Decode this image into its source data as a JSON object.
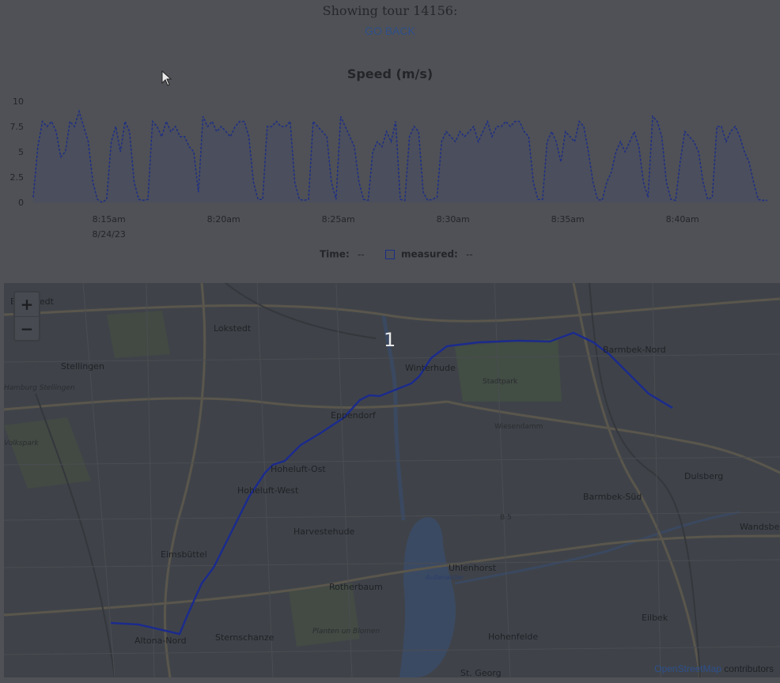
{
  "header": {
    "title": "Showing tour 14156:",
    "back_link": "GO BACK"
  },
  "chart": {
    "title": "Speed (m/s)"
  },
  "legend": {
    "time_label": "Time:",
    "time_value": "--",
    "series_label": "measured:",
    "series_value": "--"
  },
  "chart_data": {
    "type": "area",
    "title": "Speed (m/s)",
    "xlabel": "",
    "ylabel": "",
    "ylim": [
      0,
      10
    ],
    "yticks": [
      "0",
      "2.5",
      "5",
      "7.5",
      "10"
    ],
    "xticks": [
      {
        "time": "8:15am",
        "date": "8/24/23"
      },
      {
        "time": "8:20am",
        "date": ""
      },
      {
        "time": "8:25am",
        "date": ""
      },
      {
        "time": "8:30am",
        "date": ""
      },
      {
        "time": "8:35am",
        "date": ""
      },
      {
        "time": "8:40am",
        "date": ""
      }
    ],
    "x_minutes": [
      0,
      0.2,
      0.4,
      0.6,
      0.8,
      1.0,
      1.2,
      1.4,
      1.6,
      1.8,
      2.0,
      2.2,
      2.4,
      2.6,
      2.8,
      3.0,
      3.2,
      3.4,
      3.6,
      3.8,
      4.0,
      4.2,
      4.4,
      4.6,
      4.8,
      5.0,
      5.2,
      5.4,
      5.6,
      5.8,
      6.0,
      6.2,
      6.4,
      6.6,
      6.8,
      7.0,
      7.2,
      7.4,
      7.6,
      7.8,
      8.0,
      8.2,
      8.4,
      8.6,
      8.8,
      9.0,
      9.2,
      9.4,
      9.6,
      9.8,
      10.0,
      10.2,
      10.4,
      10.6,
      10.8,
      11.0,
      11.2,
      11.4,
      11.6,
      11.8,
      12.0,
      12.2,
      12.4,
      12.6,
      12.8,
      13.0,
      13.2,
      13.4,
      13.6,
      13.8,
      14.0,
      14.2,
      14.4,
      14.6,
      14.8,
      15.0,
      15.2,
      15.4,
      15.6,
      15.8,
      16.0,
      16.2,
      16.4,
      16.6,
      16.8,
      17.0,
      17.2,
      17.4,
      17.6,
      17.8,
      18.0,
      18.2,
      18.4,
      18.6,
      18.8,
      19.0,
      19.2,
      19.4,
      19.6,
      19.8,
      20.0,
      20.2,
      20.4,
      20.6,
      20.8,
      21.0,
      21.2,
      21.4,
      21.6,
      21.8,
      22.0,
      22.2,
      22.4,
      22.6,
      22.8,
      23.0,
      23.2,
      23.4,
      23.6,
      23.8,
      24.0,
      24.2,
      24.4,
      24.6,
      24.8,
      25.0,
      25.2,
      25.4,
      25.6,
      25.8,
      26.0,
      26.2,
      26.4,
      26.6,
      26.8,
      27.0,
      27.2,
      27.4,
      27.6,
      27.8,
      28.0,
      28.2,
      28.4,
      28.6,
      28.8,
      29.0,
      29.2,
      29.4,
      29.6,
      29.8,
      30.0,
      30.2,
      30.4,
      30.6,
      30.8,
      31.0,
      31.2,
      31.4,
      31.6,
      31.8,
      32.0
    ],
    "series": [
      {
        "values": [
          0.5,
          5.5,
          8.0,
          7.5,
          8.0,
          7.0,
          4.5,
          5.0,
          8.0,
          7.5,
          9.0,
          7.5,
          6.0,
          2.0,
          0.3,
          0.0,
          0.3,
          6.0,
          7.5,
          5.0,
          8.0,
          7.0,
          2.0,
          0.3,
          0.2,
          0.3,
          8.0,
          7.5,
          6.5,
          8.0,
          7.0,
          7.5,
          6.5,
          6.5,
          5.5,
          5.0,
          1.0,
          8.5,
          7.5,
          8.0,
          7.0,
          7.5,
          7.0,
          6.5,
          7.5,
          8.0,
          8.0,
          6.5,
          2.0,
          0.3,
          0.3,
          7.5,
          7.5,
          8.0,
          7.5,
          7.5,
          8.0,
          2.0,
          0.3,
          0.2,
          0.3,
          8.0,
          7.5,
          7.0,
          6.5,
          2.0,
          0.3,
          8.5,
          7.5,
          6.5,
          5.5,
          2.0,
          0.3,
          0.2,
          5.0,
          6.0,
          5.5,
          7.0,
          6.0,
          8.0,
          0.3,
          0.2,
          6.5,
          7.5,
          7.0,
          1.0,
          0.2,
          0.3,
          0.5,
          6.0,
          7.0,
          6.5,
          6.0,
          7.0,
          6.5,
          7.0,
          7.5,
          6.0,
          7.0,
          8.0,
          6.5,
          7.5,
          7.5,
          8.0,
          7.5,
          8.0,
          8.0,
          7.0,
          6.5,
          2.0,
          0.3,
          0.3,
          6.0,
          7.0,
          6.0,
          4.0,
          7.0,
          6.5,
          6.0,
          8.0,
          7.5,
          5.0,
          2.0,
          0.3,
          0.2,
          2.0,
          3.0,
          5.0,
          6.0,
          5.0,
          6.0,
          7.0,
          5.5,
          2.0,
          0.5,
          8.5,
          8.0,
          6.5,
          2.0,
          0.3,
          0.2,
          4.0,
          7.0,
          6.5,
          6.0,
          5.0,
          2.0,
          0.3,
          0.5,
          7.5,
          7.5,
          6.0,
          7.0,
          7.5,
          6.5,
          5.0,
          4.0,
          2.0,
          0.3,
          0.2,
          0.2
        ]
      }
    ]
  },
  "map": {
    "zoom_in": "+",
    "zoom_out": "−",
    "marker": "1",
    "attribution_link": "OpenStreetMap",
    "attribution_rest": " contributors",
    "labels": [
      {
        "text": "Eidelstedt",
        "cls": ""
      },
      {
        "text": "Lokstedt",
        "cls": ""
      },
      {
        "text": "Stellingen",
        "cls": ""
      },
      {
        "text": "Hamburg Stellingen",
        "cls": "italic"
      },
      {
        "text": "Volkspark",
        "cls": "italic"
      },
      {
        "text": "Winterhude",
        "cls": ""
      },
      {
        "text": "Barmbek-Nord",
        "cls": ""
      },
      {
        "text": "Eppendorf",
        "cls": ""
      },
      {
        "text": "Stadtpark",
        "cls": "small"
      },
      {
        "text": "Wiesendamm",
        "cls": "small"
      },
      {
        "text": "Hoheluft-Ost",
        "cls": ""
      },
      {
        "text": "Hoheluft-West",
        "cls": ""
      },
      {
        "text": "Dulsberg",
        "cls": ""
      },
      {
        "text": "Barmbek-Süd",
        "cls": ""
      },
      {
        "text": "Harvestehude",
        "cls": ""
      },
      {
        "text": "B 5",
        "cls": "small"
      },
      {
        "text": "Wandsbek",
        "cls": ""
      },
      {
        "text": "Eimsbüttel",
        "cls": ""
      },
      {
        "text": "Uhlenhorst",
        "cls": ""
      },
      {
        "text": "Rotherbaum",
        "cls": ""
      },
      {
        "text": "Eilbek",
        "cls": ""
      },
      {
        "text": "Außenalster",
        "cls": "blue"
      },
      {
        "text": "Altona-Nord",
        "cls": ""
      },
      {
        "text": "Sternschanze",
        "cls": ""
      },
      {
        "text": "Planten un Blomen",
        "cls": "italic"
      },
      {
        "text": "Hohenfelde",
        "cls": ""
      },
      {
        "text": "St. Georg",
        "cls": ""
      }
    ]
  },
  "colors": {
    "background": "#4f5156",
    "line": "#1d2f86",
    "route": "#1c2b8c",
    "map_bg": "#3f4349"
  }
}
